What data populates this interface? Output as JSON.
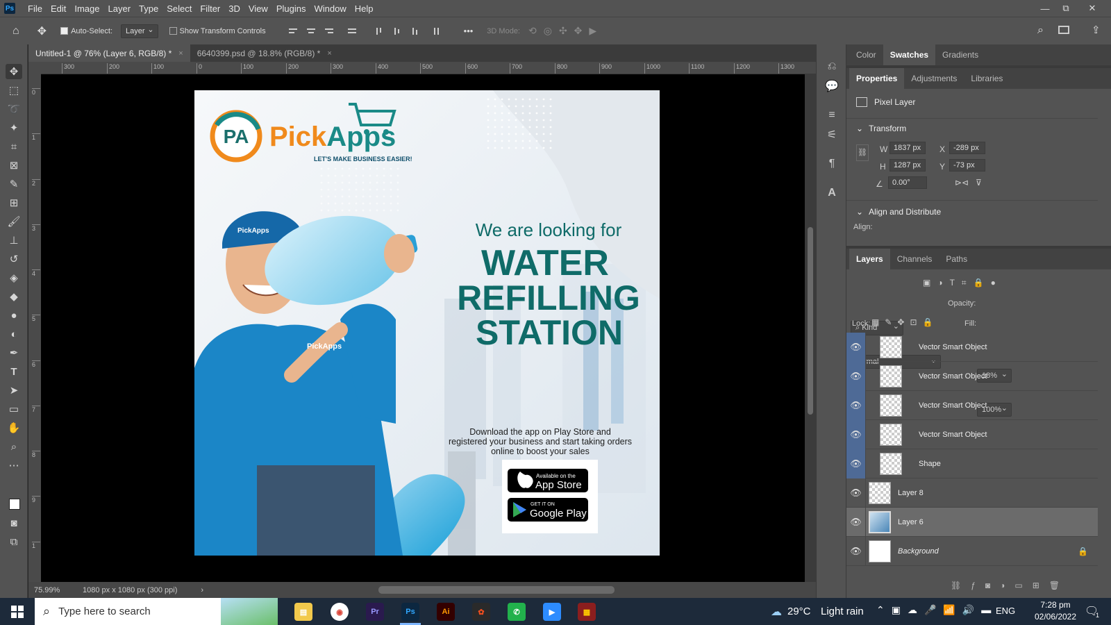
{
  "app": {
    "logo": "Ps"
  },
  "menu": [
    "File",
    "Edit",
    "Image",
    "Layer",
    "Type",
    "Select",
    "Filter",
    "3D",
    "View",
    "Plugins",
    "Window",
    "Help"
  ],
  "window_controls": {
    "minimize": "—",
    "restore": "⧉",
    "close": "✕"
  },
  "options_bar": {
    "auto_select_label": "Auto-Select:",
    "auto_select_value": "Layer",
    "show_transform_label": "Show Transform Controls",
    "more": "•••",
    "mode_3d_label": "3D Mode:"
  },
  "tabs": [
    {
      "label": "Untitled-1 @ 76% (Layer 6, RGB/8) *",
      "close": "×"
    },
    {
      "label": "6640399.psd @ 18.8% (RGB/8) *",
      "close": "×"
    }
  ],
  "ruler_h": [
    "300",
    "200",
    "100",
    "0",
    "100",
    "200",
    "300",
    "400",
    "500",
    "600",
    "700",
    "800",
    "900",
    "1000",
    "1100",
    "1200",
    "1300"
  ],
  "ruler_v": [
    "0",
    "1",
    "2",
    "3",
    "4",
    "5",
    "6",
    "7",
    "8",
    "9",
    "1"
  ],
  "poster": {
    "brand": "PickApps",
    "brand_pick": "Pick",
    "brand_apps": "Apps",
    "logo_initials": "PA",
    "tagline": "LET'S MAKE BUSINESS EASIER!",
    "cap_brand": "PickApps",
    "shirt_brand": "PickApps",
    "heading_small": "We are looking for",
    "heading_line1": "WATER",
    "heading_line2": "REFILLING",
    "heading_line3": "STATION",
    "body_line1": "Download the app on Play Store and",
    "body_line2": "registered your business and start taking orders",
    "body_line3": "online to boost your sales",
    "appstore_small": "Available on the",
    "appstore_big": "App Store",
    "google_small": "GET IT ON",
    "google_big": "Google Play"
  },
  "status": {
    "zoom": "75.99%",
    "doc_info": "1080 px x 1080 px (300 ppi)"
  },
  "panel_tabs_top": [
    "Color",
    "Swatches",
    "Gradients"
  ],
  "panel_tabs_mid": [
    "Properties",
    "Adjustments",
    "Libraries"
  ],
  "properties": {
    "layer_type": "Pixel Layer",
    "transform_title": "Transform",
    "w_label": "W",
    "w": "1837 px",
    "x_label": "X",
    "x": "-289 px",
    "h_label": "H",
    "h": "1287 px",
    "y_label": "Y",
    "y": "-73 px",
    "angle": "0.00°",
    "align_title": "Align and Distribute",
    "align_label": "Align:"
  },
  "layer_tabs": [
    "Layers",
    "Channels",
    "Paths"
  ],
  "layers_controls": {
    "kind": "Kind",
    "blend": "Normal",
    "opacity_label": "Opacity:",
    "opacity": "18%",
    "lock_label": "Lock:",
    "fill_label": "Fill:",
    "fill": "100%"
  },
  "layers": [
    {
      "name": "Vector Smart Object"
    },
    {
      "name": "Vector Smart Object"
    },
    {
      "name": "Vector Smart Object"
    },
    {
      "name": "Vector Smart Object"
    },
    {
      "name": "Shape"
    },
    {
      "name": "Layer 8"
    },
    {
      "name": "Layer 6"
    },
    {
      "name": "Background"
    }
  ],
  "taskbar": {
    "search": "Type here to search",
    "weather_temp": "29°C",
    "weather": "Light rain",
    "lang": "ENG",
    "time": "7:28 pm",
    "date": "02/06/2022",
    "notif": "1",
    "apps": [
      "Pr",
      "Ps",
      "Ai"
    ]
  },
  "colors": {
    "brand_teal": "#0f6b68",
    "brand_orange": "#f08a1c",
    "shirt": "#1b86c7"
  }
}
